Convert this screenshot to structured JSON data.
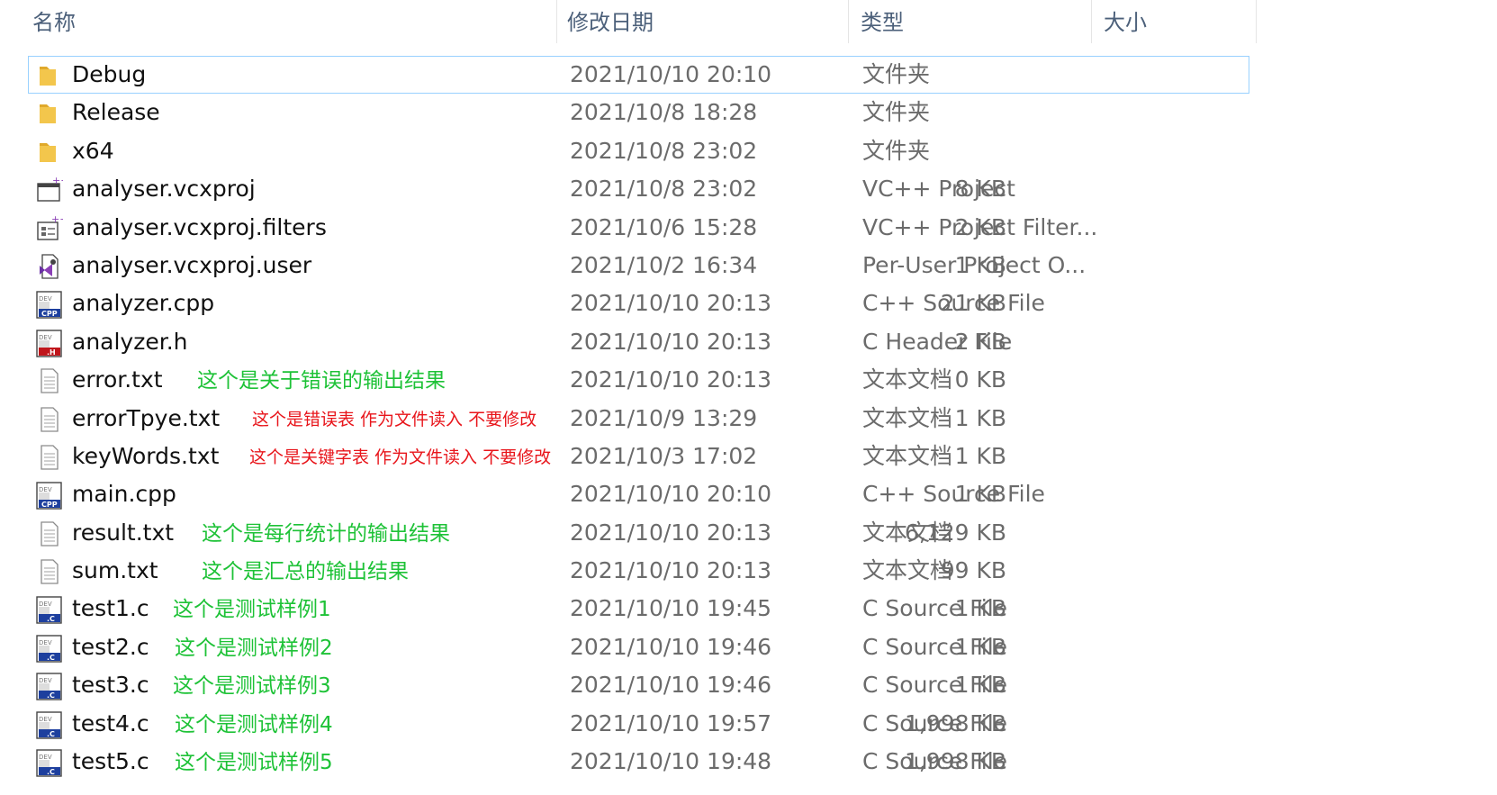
{
  "header": {
    "name": "名称",
    "modified": "修改日期",
    "type": "类型",
    "size": "大小"
  },
  "files": [
    {
      "name": "Debug",
      "date": "2021/10/10 20:10",
      "type": "文件夹",
      "size": "",
      "icon": "folder-icon",
      "selected": true
    },
    {
      "name": "Release",
      "date": "2021/10/8 18:28",
      "type": "文件夹",
      "size": "",
      "icon": "folder-icon"
    },
    {
      "name": "x64",
      "date": "2021/10/8 23:02",
      "type": "文件夹",
      "size": "",
      "icon": "folder-icon"
    },
    {
      "name": "analyser.vcxproj",
      "date": "2021/10/8 23:02",
      "type": "VC++ Project",
      "size": "8 KB",
      "icon": "vcxproj-icon"
    },
    {
      "name": "analyser.vcxproj.filters",
      "date": "2021/10/6 15:28",
      "type": "VC++ Project Filter...",
      "size": "2 KB",
      "icon": "vcxproj-filters-icon"
    },
    {
      "name": "analyser.vcxproj.user",
      "date": "2021/10/2 16:34",
      "type": "Per-User Project O...",
      "size": "1 KB",
      "icon": "visual-studio-user-icon"
    },
    {
      "name": "analyzer.cpp",
      "date": "2021/10/10 20:13",
      "type": "C++ Source File",
      "size": "21 KB",
      "icon": "cpp-file-icon"
    },
    {
      "name": "analyzer.h",
      "date": "2021/10/10 20:13",
      "type": "C Header File",
      "size": "2 KB",
      "icon": "h-file-icon"
    },
    {
      "name": "error.txt",
      "date": "2021/10/10 20:13",
      "type": "文本文档",
      "size": "0 KB",
      "icon": "text-file-icon",
      "note": "这个是关于错误的输出结果",
      "note_color": "green"
    },
    {
      "name": "errorTpye.txt",
      "date": "2021/10/9 13:29",
      "type": "文本文档",
      "size": "1 KB",
      "icon": "text-file-icon",
      "note": "这个是错误表 作为文件读入 不要修改",
      "note_color": "red"
    },
    {
      "name": "keyWords.txt",
      "date": "2021/10/3 17:02",
      "type": "文本文档",
      "size": "1 KB",
      "icon": "text-file-icon",
      "note": "这个是关键字表 作为文件读入 不要修改",
      "note_color": "red"
    },
    {
      "name": "main.cpp",
      "date": "2021/10/10 20:10",
      "type": "C++ Source File",
      "size": "1 KB",
      "icon": "cpp-file-icon"
    },
    {
      "name": "result.txt",
      "date": "2021/10/10 20:13",
      "type": "文本文档",
      "size": "6,129 KB",
      "icon": "text-file-icon",
      "note": "这个是每行统计的输出结果",
      "note_color": "green"
    },
    {
      "name": "sum.txt",
      "date": "2021/10/10 20:13",
      "type": "文本文档",
      "size": "99 KB",
      "icon": "text-file-icon",
      "note": "这个是汇总的输出结果",
      "note_color": "green"
    },
    {
      "name": "test1.c",
      "date": "2021/10/10 19:45",
      "type": "C Source File",
      "size": "1 KB",
      "icon": "c-file-icon",
      "note": "这个是测试样例1",
      "note_color": "green"
    },
    {
      "name": "test2.c",
      "date": "2021/10/10 19:46",
      "type": "C Source File",
      "size": "1 KB",
      "icon": "c-file-icon",
      "note": "这个是测试样例2",
      "note_color": "green"
    },
    {
      "name": "test3.c",
      "date": "2021/10/10 19:46",
      "type": "C Source File",
      "size": "1 KB",
      "icon": "c-file-icon",
      "note": "这个是测试样例3",
      "note_color": "green"
    },
    {
      "name": "test4.c",
      "date": "2021/10/10 19:57",
      "type": "C Source File",
      "size": "1,998 KB",
      "icon": "c-file-icon",
      "note": "这个是测试样例4",
      "note_color": "green"
    },
    {
      "name": "test5.c",
      "date": "2021/10/10 19:48",
      "type": "C Source File",
      "size": "1,998 KB",
      "icon": "c-file-icon",
      "note": "这个是测试样例5",
      "note_color": "green"
    }
  ],
  "colors": {
    "header_text": "#4c607a",
    "selection_border": "#99d1ff",
    "note_green": "#1ec237",
    "note_red": "#e8151b",
    "folder": "#f3c64c"
  }
}
